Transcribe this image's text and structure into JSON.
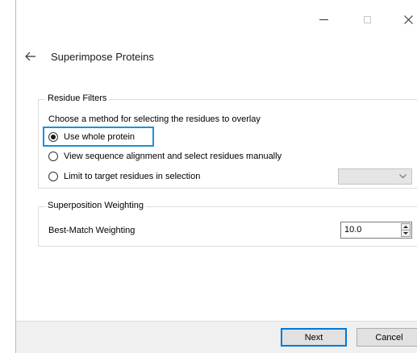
{
  "window": {
    "controls": {
      "minimize_icon": "minimize-icon",
      "maximize_icon": "maximize-icon",
      "close_icon": "close-icon"
    }
  },
  "header": {
    "back_icon": "arrow-left-icon",
    "title": "Superimpose Proteins"
  },
  "residue_filters": {
    "group_label": "Residue Filters",
    "instruction": "Choose a method for selecting the residues to overlay",
    "options": [
      {
        "label": "Use whole protein",
        "selected": true
      },
      {
        "label": "View sequence alignment and select residues manually",
        "selected": false
      },
      {
        "label": "Limit to target residues in selection",
        "selected": false
      }
    ],
    "target_combo": {
      "value": "",
      "enabled": false
    }
  },
  "superposition_weighting": {
    "group_label": "Superposition Weighting",
    "best_match_label": "Best-Match Weighting",
    "best_match_value": "10.0"
  },
  "footer": {
    "next_label": "Next",
    "cancel_label": "Cancel"
  },
  "colors": {
    "focus_ring": "#1e90d6",
    "default_button_border": "#0078d7",
    "footer_bg": "#f0f0f0",
    "disabled_combo_bg": "#e5e5e5"
  }
}
